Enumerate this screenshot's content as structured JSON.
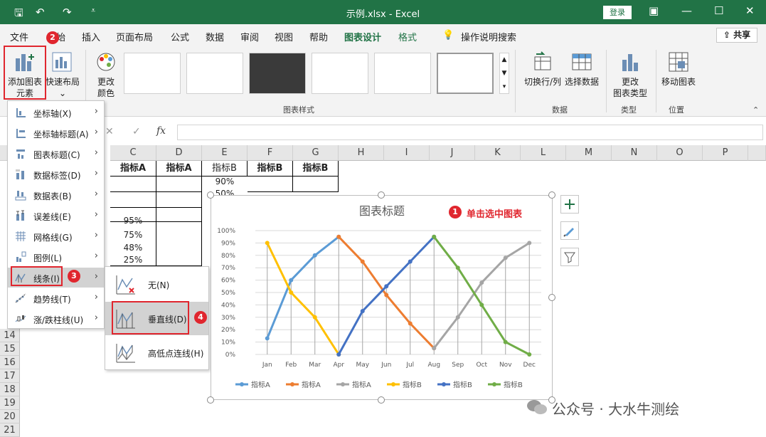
{
  "titlebar": {
    "title": "示例.xlsx - Excel",
    "login": "登录",
    "save_icon": "save-icon",
    "undo_icon": "undo-icon",
    "redo_icon": "redo-icon"
  },
  "menu": {
    "tabs": [
      "文件",
      "开始",
      "插入",
      "页面布局",
      "公式",
      "数据",
      "审阅",
      "视图",
      "帮助",
      "图表设计",
      "格式"
    ],
    "active_tab": "图表设计",
    "accent_tab": "格式",
    "search": "操作说明搜索",
    "share": "共享"
  },
  "ribbon": {
    "add_element_line1": "添加图表",
    "add_element_line2": "元素",
    "quick_layout_line1": "快速布局",
    "change_colors_line1": "更改",
    "change_colors_line2": "颜色",
    "switch_rowcol": "切换行/列",
    "select_data": "选择数据",
    "change_type_line1": "更改",
    "change_type_line2": "图表类型",
    "move_chart": "移动图表",
    "groups": {
      "styles": "图表样式",
      "data": "数据",
      "type": "类型",
      "location": "位置"
    }
  },
  "formulabar": {
    "cancel": "✕",
    "enter": "✓",
    "fx": "fx"
  },
  "grid": {
    "columns": [
      "C",
      "D",
      "E",
      "F",
      "G",
      "H",
      "I",
      "J",
      "K",
      "L",
      "M",
      "N",
      "O",
      "P"
    ],
    "header_row": [
      "指标A",
      "指标A",
      "指标B",
      "指标B",
      "指标B"
    ],
    "e_values": [
      "90%",
      "50%"
    ],
    "c_values": [
      "95%",
      "75%",
      "48%",
      "25%"
    ],
    "row_numbers": [
      "14",
      "15",
      "16",
      "17",
      "18",
      "19",
      "20",
      "21"
    ]
  },
  "dropdown": {
    "items": [
      {
        "label": "坐标轴(X)",
        "icon": "axis-icon"
      },
      {
        "label": "坐标轴标题(A)",
        "icon": "axis-title-icon"
      },
      {
        "label": "图表标题(C)",
        "icon": "chart-title-icon"
      },
      {
        "label": "数据标签(D)",
        "icon": "data-labels-icon"
      },
      {
        "label": "数据表(B)",
        "icon": "data-table-icon"
      },
      {
        "label": "误差线(E)",
        "icon": "error-bars-icon"
      },
      {
        "label": "网格线(G)",
        "icon": "gridlines-icon"
      },
      {
        "label": "图例(L)",
        "icon": "legend-icon"
      },
      {
        "label": "线条(I)",
        "icon": "lines-icon"
      },
      {
        "label": "趋势线(T)",
        "icon": "trendline-icon"
      },
      {
        "label": "涨/跌柱线(U)",
        "icon": "updown-bars-icon"
      }
    ],
    "submenu": [
      {
        "label": "无(N)",
        "icon": "no-lines-icon"
      },
      {
        "label": "垂直线(D)",
        "icon": "drop-lines-icon"
      },
      {
        "label": "高低点连线(H)",
        "icon": "high-low-lines-icon"
      }
    ]
  },
  "annotations": {
    "badge1": "1",
    "badge1_text": "单击选中图表",
    "badge2": "2",
    "badge3": "3",
    "badge4": "4"
  },
  "chart_data": {
    "type": "line",
    "title": "图表标题",
    "categories": [
      "Jan",
      "Feb",
      "Mar",
      "Apr",
      "May",
      "Jun",
      "Jul",
      "Aug",
      "Sep",
      "Oct",
      "Nov",
      "Dec"
    ],
    "ylim": [
      0,
      100
    ],
    "yticks": [
      "0%",
      "10%",
      "20%",
      "30%",
      "40%",
      "50%",
      "60%",
      "70%",
      "80%",
      "90%",
      "100%"
    ],
    "drop_lines": true,
    "legend": "bottom",
    "series": [
      {
        "name": "指标A",
        "color": "#5b9bd5",
        "values": [
          13,
          60,
          80,
          95,
          null,
          null,
          null,
          null,
          null,
          null,
          null,
          null
        ]
      },
      {
        "name": "指标A",
        "color": "#ed7d31",
        "values": [
          null,
          null,
          null,
          95,
          75,
          48,
          25,
          5,
          null,
          null,
          null,
          null
        ]
      },
      {
        "name": "指标A",
        "color": "#a5a5a5",
        "values": [
          null,
          null,
          null,
          null,
          null,
          null,
          null,
          5,
          30,
          58,
          78,
          90
        ]
      },
      {
        "name": "指标B",
        "color": "#ffc000",
        "values": [
          90,
          50,
          30,
          0,
          null,
          null,
          null,
          null,
          null,
          null,
          null,
          null
        ]
      },
      {
        "name": "指标B",
        "color": "#4472c4",
        "values": [
          null,
          null,
          null,
          0,
          35,
          55,
          75,
          95,
          null,
          null,
          null,
          null
        ]
      },
      {
        "name": "指标B",
        "color": "#70ad47",
        "values": [
          null,
          null,
          null,
          null,
          null,
          null,
          null,
          95,
          70,
          40,
          10,
          0
        ]
      }
    ]
  },
  "watermark": "公众号 · 大水牛测绘"
}
